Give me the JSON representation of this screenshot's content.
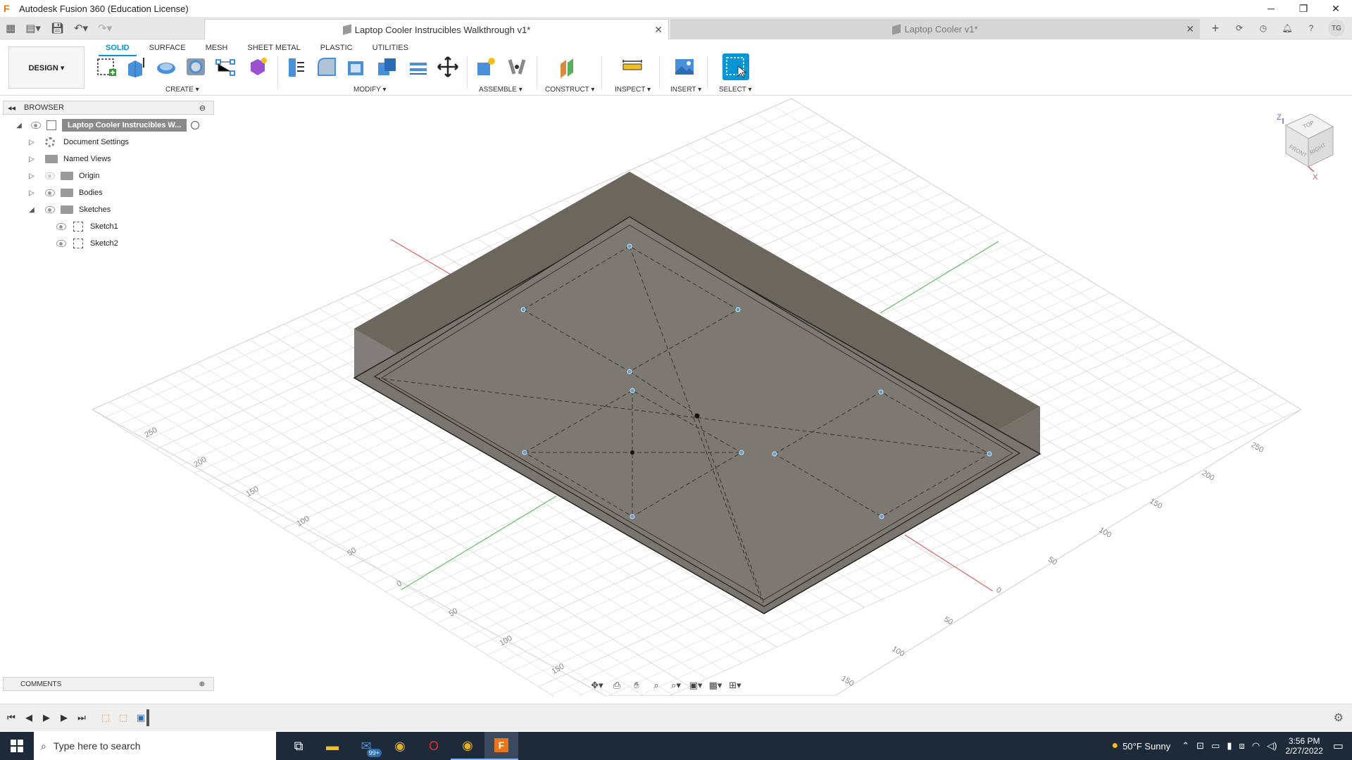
{
  "window": {
    "title": "Autodesk Fusion 360 (Education License)",
    "logo_letter": "F",
    "minimize": "─",
    "maximize": "❐",
    "close": "✕"
  },
  "tabs": {
    "active_label": "Laptop Cooler Instrucibles Walkthrough v1*",
    "inactive_label": "Laptop Cooler v1*",
    "close_glyph": "✕",
    "new_tab": "+",
    "user_initials": "TG"
  },
  "ribbon": {
    "workspace": "DESIGN ▾",
    "tabs": [
      "SOLID",
      "SURFACE",
      "MESH",
      "SHEET METAL",
      "PLASTIC",
      "UTILITIES"
    ],
    "groups": {
      "create": "CREATE ▾",
      "modify": "MODIFY ▾",
      "assemble": "ASSEMBLE ▾",
      "construct": "CONSTRUCT ▾",
      "inspect": "INSPECT ▾",
      "insert": "INSERT ▾",
      "select": "SELECT ▾"
    }
  },
  "browser": {
    "title": "BROWSER",
    "root": "Laptop Cooler Instrucibles W...",
    "items": [
      {
        "label": "Document Settings",
        "icon": "gear-icon"
      },
      {
        "label": "Named Views",
        "icon": "folder-icon"
      },
      {
        "label": "Origin",
        "icon": "folder-icon"
      },
      {
        "label": "Bodies",
        "icon": "folder-icon"
      },
      {
        "label": "Sketches",
        "icon": "folder-icon"
      }
    ],
    "sketches": [
      "Sketch1",
      "Sketch2"
    ]
  },
  "comments": {
    "title": "COMMENTS"
  },
  "viewcube": {
    "top": "TOP",
    "front": "FRONT",
    "right": "RIGHT",
    "z": "Z",
    "x": "X"
  },
  "grid_labels": {
    "left": [
      "250",
      "200",
      "150",
      "100",
      "50",
      "0",
      "50",
      "100",
      "150"
    ],
    "right": [
      "250",
      "200",
      "150",
      "100",
      "50",
      "0",
      "50",
      "100",
      "150"
    ]
  },
  "taskbar": {
    "search_placeholder": "Type here to search",
    "mail_badge": "99+",
    "weather": "50°F  Sunny",
    "time": "3:56 PM",
    "date": "2/27/2022"
  }
}
